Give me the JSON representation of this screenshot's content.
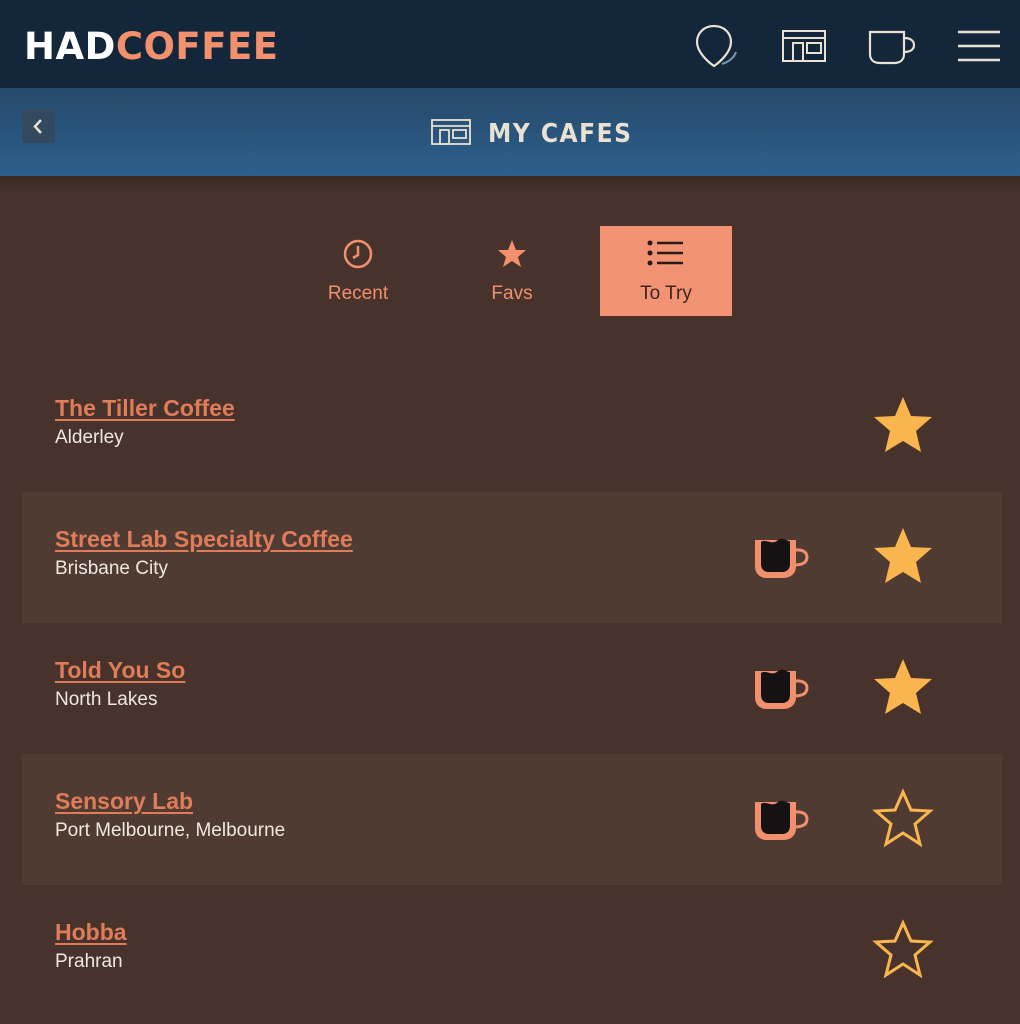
{
  "app": {
    "logo_part1": "HAD",
    "logo_part2": "COFFEE",
    "nav_icons": [
      "location-pin-icon",
      "cafe-storefront-icon",
      "coffee-cup-icon",
      "hamburger-menu-icon"
    ]
  },
  "header": {
    "title": "MY CAFES",
    "title_icon": "cafe-storefront-icon",
    "back_icon": "chevron-left-icon"
  },
  "tabs": [
    {
      "label": "Recent",
      "icon": "clock-icon",
      "active": false
    },
    {
      "label": "Favs",
      "icon": "star-icon",
      "active": false
    },
    {
      "label": "To Try",
      "icon": "list-icon",
      "active": true
    }
  ],
  "cafes": [
    {
      "name": "The Tiller Coffee",
      "location": "Alderley",
      "had_coffee": false,
      "favourite": true
    },
    {
      "name": "Street Lab Specialty Coffee",
      "location": "Brisbane City",
      "had_coffee": true,
      "favourite": true
    },
    {
      "name": "Told You So",
      "location": "North Lakes",
      "had_coffee": true,
      "favourite": true
    },
    {
      "name": "Sensory Lab",
      "location": "Port Melbourne, Melbourne",
      "had_coffee": true,
      "favourite": false
    },
    {
      "name": "Hobba",
      "location": "Prahran",
      "had_coffee": false,
      "favourite": false
    }
  ],
  "colors": {
    "topbar": "#14263a",
    "subbar": "#2d5f8c",
    "background": "#47332b",
    "row_alt": "#503b33",
    "accent": "#f2906e",
    "star": "#fbb54f",
    "cup_body": "#f2906e"
  }
}
